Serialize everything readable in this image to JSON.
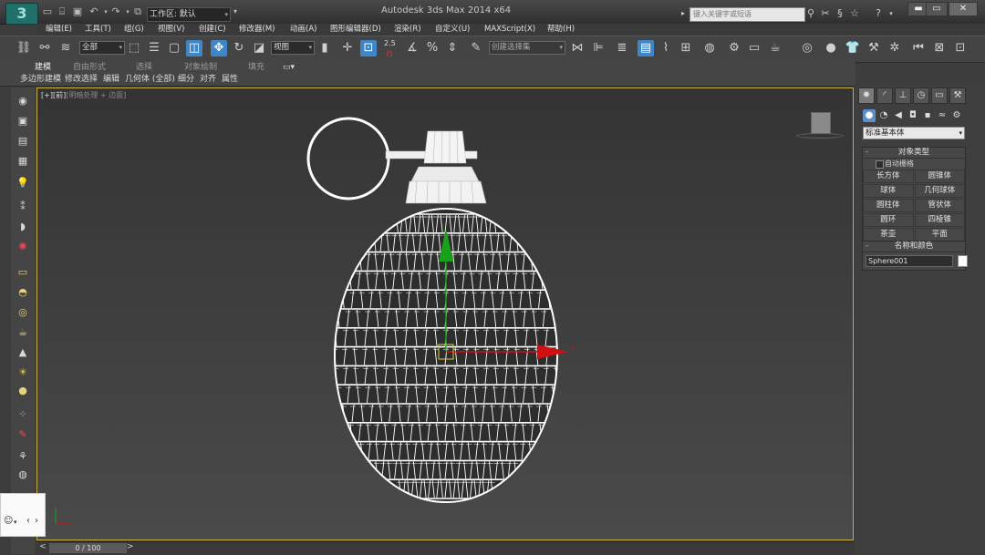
{
  "titlebar": {
    "logo": "3",
    "workspace_label": "工作区: 默认",
    "app_title": "Autodesk 3ds Max  2014 x64",
    "search_placeholder": "键入关键字或短语"
  },
  "menubar": {
    "items": [
      "编辑(E)",
      "工具(T)",
      "组(G)",
      "视图(V)",
      "创建(C)",
      "修改器(M)",
      "动画(A)",
      "图形编辑器(D)",
      "渲染(R)",
      "自定义(U)",
      "MAXScript(X)",
      "帮助(H)"
    ]
  },
  "toolbar": {
    "filter_value": "全部",
    "refcoord_value": "视图",
    "snap_value": "2.5",
    "selset_placeholder": "创建选择集"
  },
  "ribbon": {
    "tabs": [
      "建模",
      "自由形式",
      "选择",
      "对象绘制",
      "填充"
    ],
    "active_tab": "建模",
    "subtabs": [
      "多边形建模",
      "修改选择",
      "编辑",
      "几何体 (全部)",
      "细分",
      "对齐",
      "属性"
    ]
  },
  "viewport": {
    "label_plus": "[+]",
    "label_view": "[前]",
    "label_mode": "[明暗处理 + 边面]",
    "axis_x": "x",
    "wire_color": "#ffffff",
    "gizmo_y_color": "#1aa11a",
    "gizmo_x_color": "#d01010",
    "border_color": "#c8b040"
  },
  "timeslider": {
    "frame_label": "0 / 100",
    "prev": "<",
    "next": ">"
  },
  "command_panel": {
    "category_value": "标准基本体",
    "rollout_object_type": {
      "title": "对象类型",
      "autogrid_label": "自动栅格",
      "buttons": [
        "长方体",
        "圆锥体",
        "球体",
        "几何球体",
        "圆柱体",
        "管状体",
        "圆环",
        "四棱锥",
        "茶壶",
        "平面"
      ]
    },
    "rollout_name_color": {
      "title": "名称和颜色",
      "name_value": "Sphere001",
      "swatch_color": "#ffffff"
    }
  }
}
